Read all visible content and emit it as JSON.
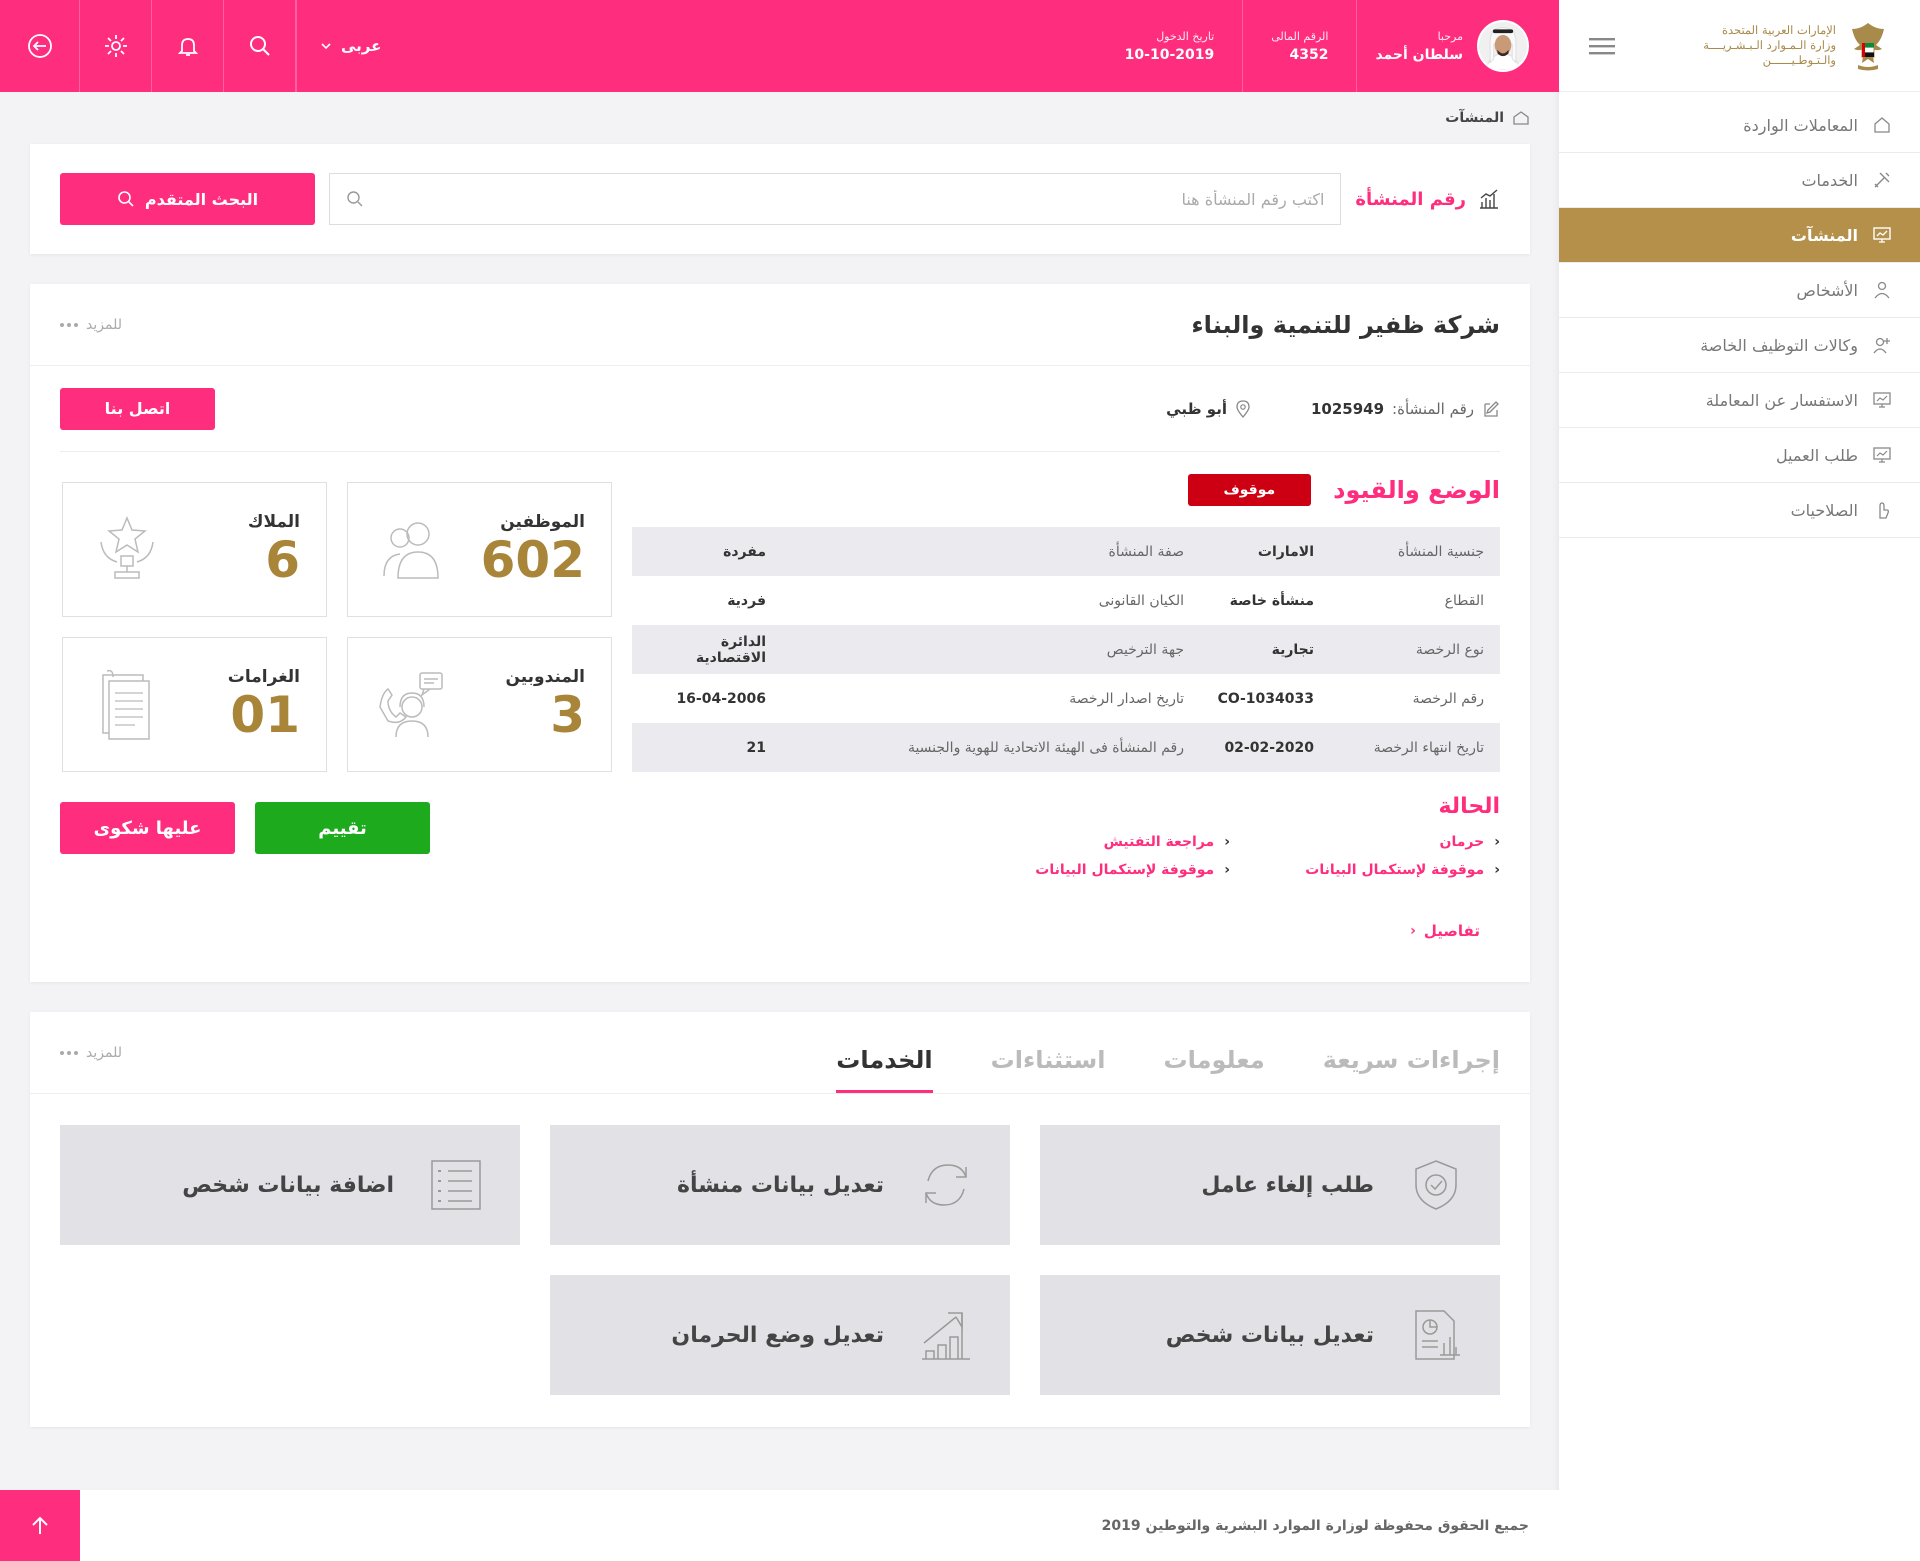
{
  "sidebar": {
    "logo_line1": "الإمارات العربية المتحدة",
    "logo_line2": "وزارة الـمـوارد الـبـشـريــــة",
    "logo_line3": "والـتـوطـيــــــن",
    "items": [
      {
        "label": "المعاملات الواردة",
        "icon": "home-icon"
      },
      {
        "label": "الخدمات",
        "icon": "tools-icon"
      },
      {
        "label": "المنشآت",
        "icon": "monitor-icon"
      },
      {
        "label": "الأشخاص",
        "icon": "person-icon"
      },
      {
        "label": "وكالات التوظيف الخاصة",
        "icon": "user-plus-icon"
      },
      {
        "label": "الاستفسار عن المعاملة",
        "icon": "monitor-icon"
      },
      {
        "label": "طلب العميل",
        "icon": "monitor-icon"
      },
      {
        "label": "الصلاحيات",
        "icon": "hand-icon"
      }
    ],
    "active_index": 2
  },
  "header": {
    "welcome": "مرحبا",
    "user_name": "سلطان أحمد",
    "finance_label": "الرقم المالى",
    "finance_value": "4352",
    "login_label": "تاريخ الدخول",
    "login_value": "10-10-2019",
    "language": "عربى"
  },
  "breadcrumb": {
    "current": "المنشآت"
  },
  "search": {
    "label": "رقم المنشأة",
    "placeholder": "اكتب رقم المنشأة هنا",
    "value": "",
    "advanced_label": "البحث المتقدم"
  },
  "company": {
    "name": "شركة ظفير للتنمية والبناء",
    "more_label": "للمزيد",
    "number_label": "رقم المنشأة:",
    "number_value": "1025949",
    "location": "أبو ظبي",
    "contact_label": "اتصل بنا",
    "status_title": "الوضع والقيود",
    "status_badge": "موقوف",
    "details": [
      {
        "l1": "جنسية المنشأة",
        "v1": "الامارات",
        "l2": "صفة المنشأة",
        "v2": "مفردة"
      },
      {
        "l1": "القطاع",
        "v1": "منشأة خاصة",
        "l2": "الكيان القانونى",
        "v2": "فردية"
      },
      {
        "l1": "نوع الرخصة",
        "v1": "تجارية",
        "l2": "جهة الترخيص",
        "v2": "الدائرة الاقتصادية"
      },
      {
        "l1": "رقم الرخصة",
        "v1": "CO-1034033",
        "l2": "تاريخ اصدار الرخصة",
        "v2": "16-04-2006"
      },
      {
        "l1": "تاريخ انتهاء الرخصة",
        "v1": "02-02-2020",
        "l2": "رقم المنشأة فى الهيئة الاتحادية للهوية والجنسية",
        "v2": "21"
      }
    ],
    "stats": {
      "employees_label": "الموظفين",
      "employees_value": "602",
      "owners_label": "الملاك",
      "owners_value": "6",
      "reps_label": "المندوبين",
      "reps_value": "3",
      "fines_label": "الغرامات",
      "fines_value": "01"
    },
    "complaint_label": "عليها شكوى",
    "rating_label": "تقييم",
    "hala_title": "الحالة",
    "hala_items": [
      "حرمان",
      "مراجعة التفتيش",
      "موقوفة لإستكمال البيانات",
      "موقوفة لإستكمال البيانات"
    ],
    "details_link": "تفاصيل"
  },
  "services": {
    "tabs": [
      "إجراءات سريعة",
      "معلومات",
      "استثناءات",
      "الخدمات"
    ],
    "active_tab": 3,
    "more_label": "للمزيد",
    "items": [
      {
        "label": "طلب إلغاء عامل",
        "icon": "shield-check-icon"
      },
      {
        "label": "تعديل بيانات منشأة",
        "icon": "refresh-icon"
      },
      {
        "label": "اضافة بيانات شخص",
        "icon": "checklist-icon"
      },
      {
        "label": "تعديل بيانات شخص",
        "icon": "report-icon"
      },
      {
        "label": "تعديل وضع الحرمان",
        "icon": "growth-chart-icon"
      }
    ]
  },
  "footer": {
    "text": "جميع الحقوق محفوظة لوزارة الموارد البشرية والتوطين 2019"
  },
  "colors": {
    "primary": "#ff2d7e",
    "gold": "#b4904a",
    "danger": "#cc0012",
    "success": "#1dab1d"
  }
}
